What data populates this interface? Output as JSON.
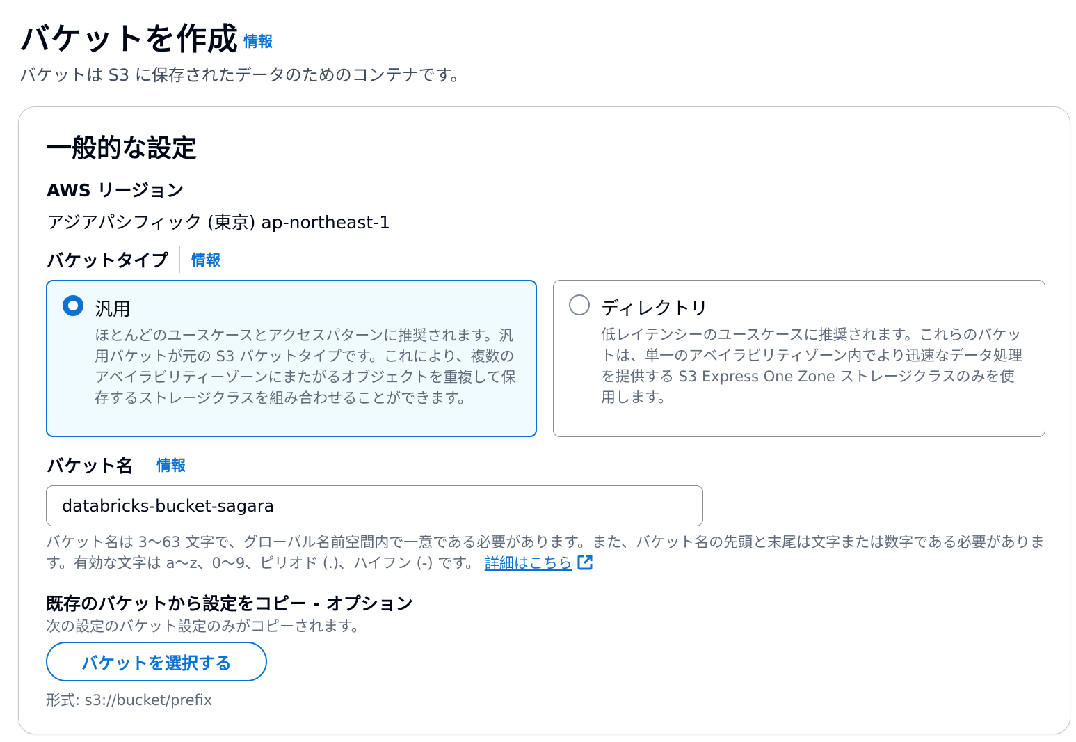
{
  "header": {
    "title": "バケットを作成",
    "info": "情報",
    "description": "バケットは S3 に保存されたデータのためのコンテナです。"
  },
  "general": {
    "title": "一般的な設定",
    "region_label": "AWS リージョン",
    "region_value": "アジアパシフィック (東京) ap-northeast-1",
    "bucket_type": {
      "label": "バケットタイプ",
      "info": "情報",
      "selected": "general_purpose",
      "options": [
        {
          "title": "汎用",
          "description": "ほとんどのユースケースとアクセスパターンに推奨されます。汎用バケットが元の S3 バケットタイプです。これにより、複数のアベイラビリティーゾーンにまたがるオブジェクトを重複して保存するストレージクラスを組み合わせることができます。"
        },
        {
          "title": "ディレクトリ",
          "description": "低レイテンシーのユースケースに推奨されます。これらのバケットは、単一のアベイラビリティゾーン内でより迅速なデータ処理を提供する S3 Express One Zone ストレージクラスのみを使用します。"
        }
      ]
    },
    "bucket_name": {
      "label": "バケット名",
      "info": "情報",
      "value": "databricks-bucket-sagara",
      "constraint": "バケット名は 3〜63 文字で、グローバル名前空間内で一意である必要があります。また、バケット名の先頭と末尾は文字または数字である必要があります。有効な文字は a〜z、0〜9、ピリオド (.)、ハイフン (-) です。",
      "learn_more": "詳細はこちら"
    },
    "copy_settings": {
      "title": "既存のバケットから設定をコピー - オプション",
      "description": "次の設定のバケット設定のみがコピーされます。",
      "button": "バケットを選択する",
      "format_hint": "形式: s3://bucket/prefix"
    }
  },
  "colors": {
    "accent": "#0972d3",
    "selected_bg": "#f0fbff",
    "text_secondary": "#5f6b7a"
  }
}
